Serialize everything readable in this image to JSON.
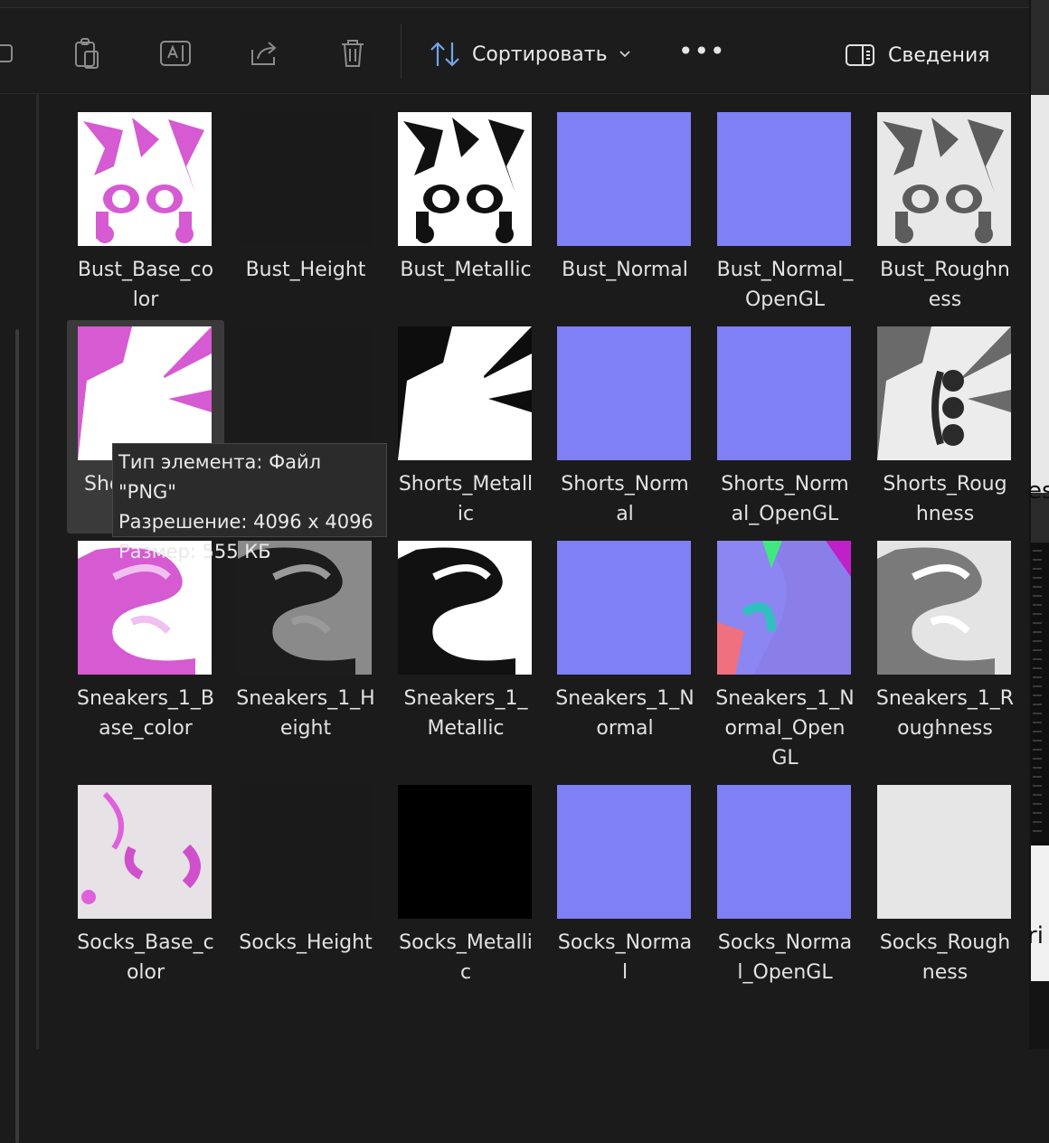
{
  "toolbar": {
    "sort_label": "Сортировать",
    "more_label": "•••",
    "details_label": "Сведения",
    "icons": [
      "rename-icon",
      "paste-icon",
      "ai-text-icon",
      "share-icon",
      "delete-icon",
      "sort-icon",
      "chevron-down-icon",
      "details-pane-icon"
    ]
  },
  "files": [
    {
      "name": "Bust_Base_color",
      "lines": [
        "Bust_Base_co",
        "lor"
      ],
      "preview": "pink-atlas"
    },
    {
      "name": "Bust_Height",
      "lines": [
        "Bust_Height"
      ],
      "preview": "dark"
    },
    {
      "name": "Bust_Metallic",
      "lines": [
        "Bust_Metallic"
      ],
      "preview": "bw-atlas"
    },
    {
      "name": "Bust_Normal",
      "lines": [
        "Bust_Normal"
      ],
      "preview": "normal"
    },
    {
      "name": "Bust_Normal_OpenGL",
      "lines": [
        "Bust_Normal_",
        "OpenGL"
      ],
      "preview": "normal"
    },
    {
      "name": "Bust_Roughness",
      "lines": [
        "Bust_Roughn",
        "ess"
      ],
      "preview": "grey-atlas"
    },
    {
      "name": "Shorts_Base_color",
      "lines": [
        "Sho",
        ""
      ],
      "preview": "pink-shorts"
    },
    {
      "name": "Shorts_Height",
      "lines": [
        ""
      ],
      "preview": "dark"
    },
    {
      "name": "Shorts_Metallic",
      "lines": [
        "Shorts_Metall",
        "ic"
      ],
      "preview": "bw-shorts"
    },
    {
      "name": "Shorts_Normal",
      "lines": [
        "Shorts_Norm",
        "al"
      ],
      "preview": "normal"
    },
    {
      "name": "Shorts_Normal_OpenGL",
      "lines": [
        "Shorts_Norm",
        "al_OpenGL"
      ],
      "preview": "normal"
    },
    {
      "name": "Shorts_Roughness",
      "lines": [
        "Shorts_Roug",
        "hness"
      ],
      "preview": "grey-shorts"
    },
    {
      "name": "Sneakers_1_Base_color",
      "lines": [
        "Sneakers_1_B",
        "ase_color"
      ],
      "preview": "pink-sneaker"
    },
    {
      "name": "Sneakers_1_Height",
      "lines": [
        "Sneakers_1_H",
        "eight"
      ],
      "preview": "dark-sneaker"
    },
    {
      "name": "Sneakers_1_Metallic",
      "lines": [
        "Sneakers_1_",
        "Metallic"
      ],
      "preview": "bw-sneaker"
    },
    {
      "name": "Sneakers_1_Normal",
      "lines": [
        "Sneakers_1_N",
        "ormal"
      ],
      "preview": "normal"
    },
    {
      "name": "Sneakers_1_Normal_OpenGL",
      "lines": [
        "Sneakers_1_N",
        "ormal_Open",
        "GL"
      ],
      "preview": "normal-color"
    },
    {
      "name": "Sneakers_1_Roughness",
      "lines": [
        "Sneakers_1_R",
        "oughness"
      ],
      "preview": "grey-sneaker"
    },
    {
      "name": "Socks_Base_color",
      "lines": [
        "Socks_Base_c",
        "olor"
      ],
      "preview": "pink-socks"
    },
    {
      "name": "Socks_Height",
      "lines": [
        "Socks_Height"
      ],
      "preview": "dark"
    },
    {
      "name": "Socks_Metallic",
      "lines": [
        "Socks_Metalli",
        "c"
      ],
      "preview": "black"
    },
    {
      "name": "Socks_Normal",
      "lines": [
        "Socks_Norma",
        "l"
      ],
      "preview": "normal"
    },
    {
      "name": "Socks_Normal_OpenGL",
      "lines": [
        "Socks_Norma",
        "l_OpenGL"
      ],
      "preview": "normal"
    },
    {
      "name": "Socks_Roughness",
      "lines": [
        "Socks_Rough",
        "ness"
      ],
      "preview": "light-grey"
    }
  ],
  "tooltip": {
    "type": "Тип элемента: Файл \"PNG\"",
    "resolution": "Разрешение: 4096 x 4096",
    "size": "Размер: 555 КБ"
  },
  "background_window": {
    "fragment_1": "es",
    "fragment_2": "ri"
  },
  "colors": {
    "accent": "#6fa6e8",
    "normal_map": "#7f7fff",
    "pink": "#d65ad2",
    "window_bg": "#1b1b1b"
  }
}
